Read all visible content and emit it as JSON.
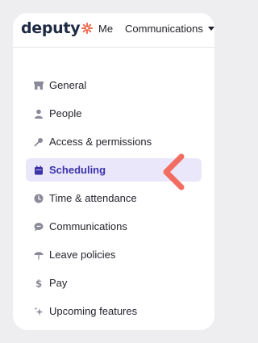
{
  "header": {
    "logo_text": "deputy",
    "nav_me": "Me",
    "nav_communications": "Communications"
  },
  "menu": {
    "items": [
      {
        "label": "General",
        "icon": "building-icon"
      },
      {
        "label": "People",
        "icon": "person-icon"
      },
      {
        "label": "Access & permissions",
        "icon": "key-icon"
      },
      {
        "label": "Scheduling",
        "icon": "calendar-icon",
        "active": true
      },
      {
        "label": "Time & attendance",
        "icon": "clock-icon"
      },
      {
        "label": "Communications",
        "icon": "chat-icon"
      },
      {
        "label": "Leave policies",
        "icon": "umbrella-icon"
      },
      {
        "label": "Pay",
        "icon": "dollar-icon"
      },
      {
        "label": "Upcoming features",
        "icon": "sparkle-icon"
      }
    ]
  },
  "colors": {
    "brand_orange": "#f06a4d",
    "active_bg": "#eae7fb",
    "active_text": "#3b32a8",
    "pointer_arrow": "#f26c60"
  }
}
